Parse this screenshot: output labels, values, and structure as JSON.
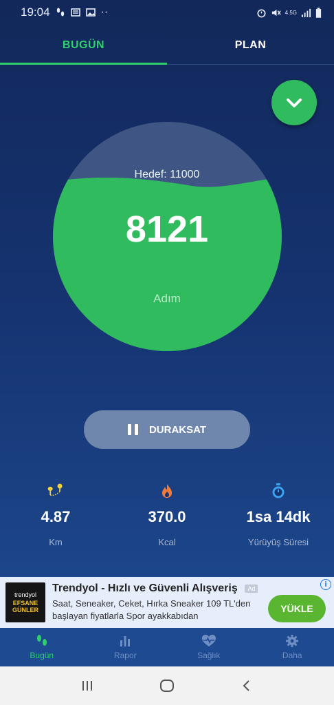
{
  "status_bar": {
    "time": "19:04",
    "network": "4.5G",
    "icons_left": [
      "footsteps-icon",
      "news-icon",
      "image-icon",
      "more-dots-icon"
    ],
    "icons_right": [
      "alarm-icon",
      "mute-icon",
      "signal-icon",
      "battery-icon"
    ]
  },
  "tabs": [
    {
      "label": "BUGÜN",
      "active": true
    },
    {
      "label": "PLAN",
      "active": false
    }
  ],
  "steps": {
    "goal_text": "Hedef: 11000",
    "count": "8121",
    "unit": "Adım",
    "fill_fraction": 0.74
  },
  "pause_button": {
    "label": "DURAKSAT"
  },
  "stats": [
    {
      "icon": "location-pins-icon",
      "value": "4.87",
      "label": "Km"
    },
    {
      "icon": "flame-icon",
      "value": "370.0",
      "label": "Kcal"
    },
    {
      "icon": "stopwatch-icon",
      "value": "1sa 14dk",
      "label": "Yürüyüş Süresi"
    }
  ],
  "ad": {
    "brand": "trendyol",
    "promo": "EFSANE GÜNLER",
    "title": "Trendyol - Hızlı ve Güvenli Alışveriş",
    "badge": "Ad",
    "description": "Saat, Seneaker, Ceket, Hırka Sneaker 109 TL'den başlayan fiyatlarla Spor ayakkabıdan",
    "install_label": "YÜKLE",
    "info": "i"
  },
  "bottom_nav": [
    {
      "label": "Bugün",
      "icon": "footsteps-icon",
      "active": true
    },
    {
      "label": "Rapor",
      "icon": "bar-chart-icon",
      "active": false
    },
    {
      "label": "Sağlık",
      "icon": "heart-pulse-icon",
      "active": false
    },
    {
      "label": "Daha",
      "icon": "gear-icon",
      "active": false
    }
  ],
  "system_nav": [
    "recents-icon",
    "home-icon",
    "back-icon"
  ],
  "colors": {
    "accent_green": "#2fd06b",
    "button_green": "#2fbb5e",
    "background_top": "#12285a",
    "background_bottom": "#1f4f97",
    "flame": "#f07a3a",
    "pin": "#f4d23a",
    "stopwatch": "#3aa3f0"
  }
}
